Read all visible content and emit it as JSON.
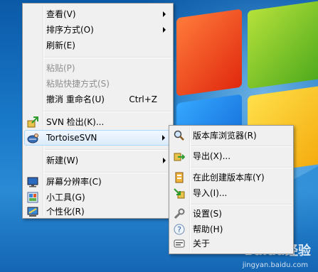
{
  "context_menu": {
    "items": [
      {
        "label": "查看(V)"
      },
      {
        "label": "排序方式(O)"
      },
      {
        "label": "刷新(E)"
      },
      {
        "label": "粘贴(P)"
      },
      {
        "label": "粘贴快捷方式(S)"
      },
      {
        "label": "撤消 重命名(U)",
        "shortcut": "Ctrl+Z"
      },
      {
        "label": "SVN 检出(K)..."
      },
      {
        "label": "TortoiseSVN"
      },
      {
        "label": "新建(W)"
      },
      {
        "label": "屏幕分辨率(C)"
      },
      {
        "label": "小工具(G)"
      },
      {
        "label": "个性化(R)"
      }
    ]
  },
  "tortoise_submenu": {
    "items": [
      {
        "label": "版本库浏览器(R)"
      },
      {
        "label": "导出(X)..."
      },
      {
        "label": "在此创建版本库(Y)"
      },
      {
        "label": "导入(I)..."
      },
      {
        "label": "设置(S)"
      },
      {
        "label": "帮助(H)"
      },
      {
        "label": "关于"
      }
    ]
  },
  "watermark": {
    "brand": "Baidu经验",
    "url": "jingyan.baidu.com"
  },
  "colors": {
    "menu_bg": "#f0f0f0",
    "hover_border": "#a8d8fb",
    "disabled_text": "#8e8e8e"
  }
}
